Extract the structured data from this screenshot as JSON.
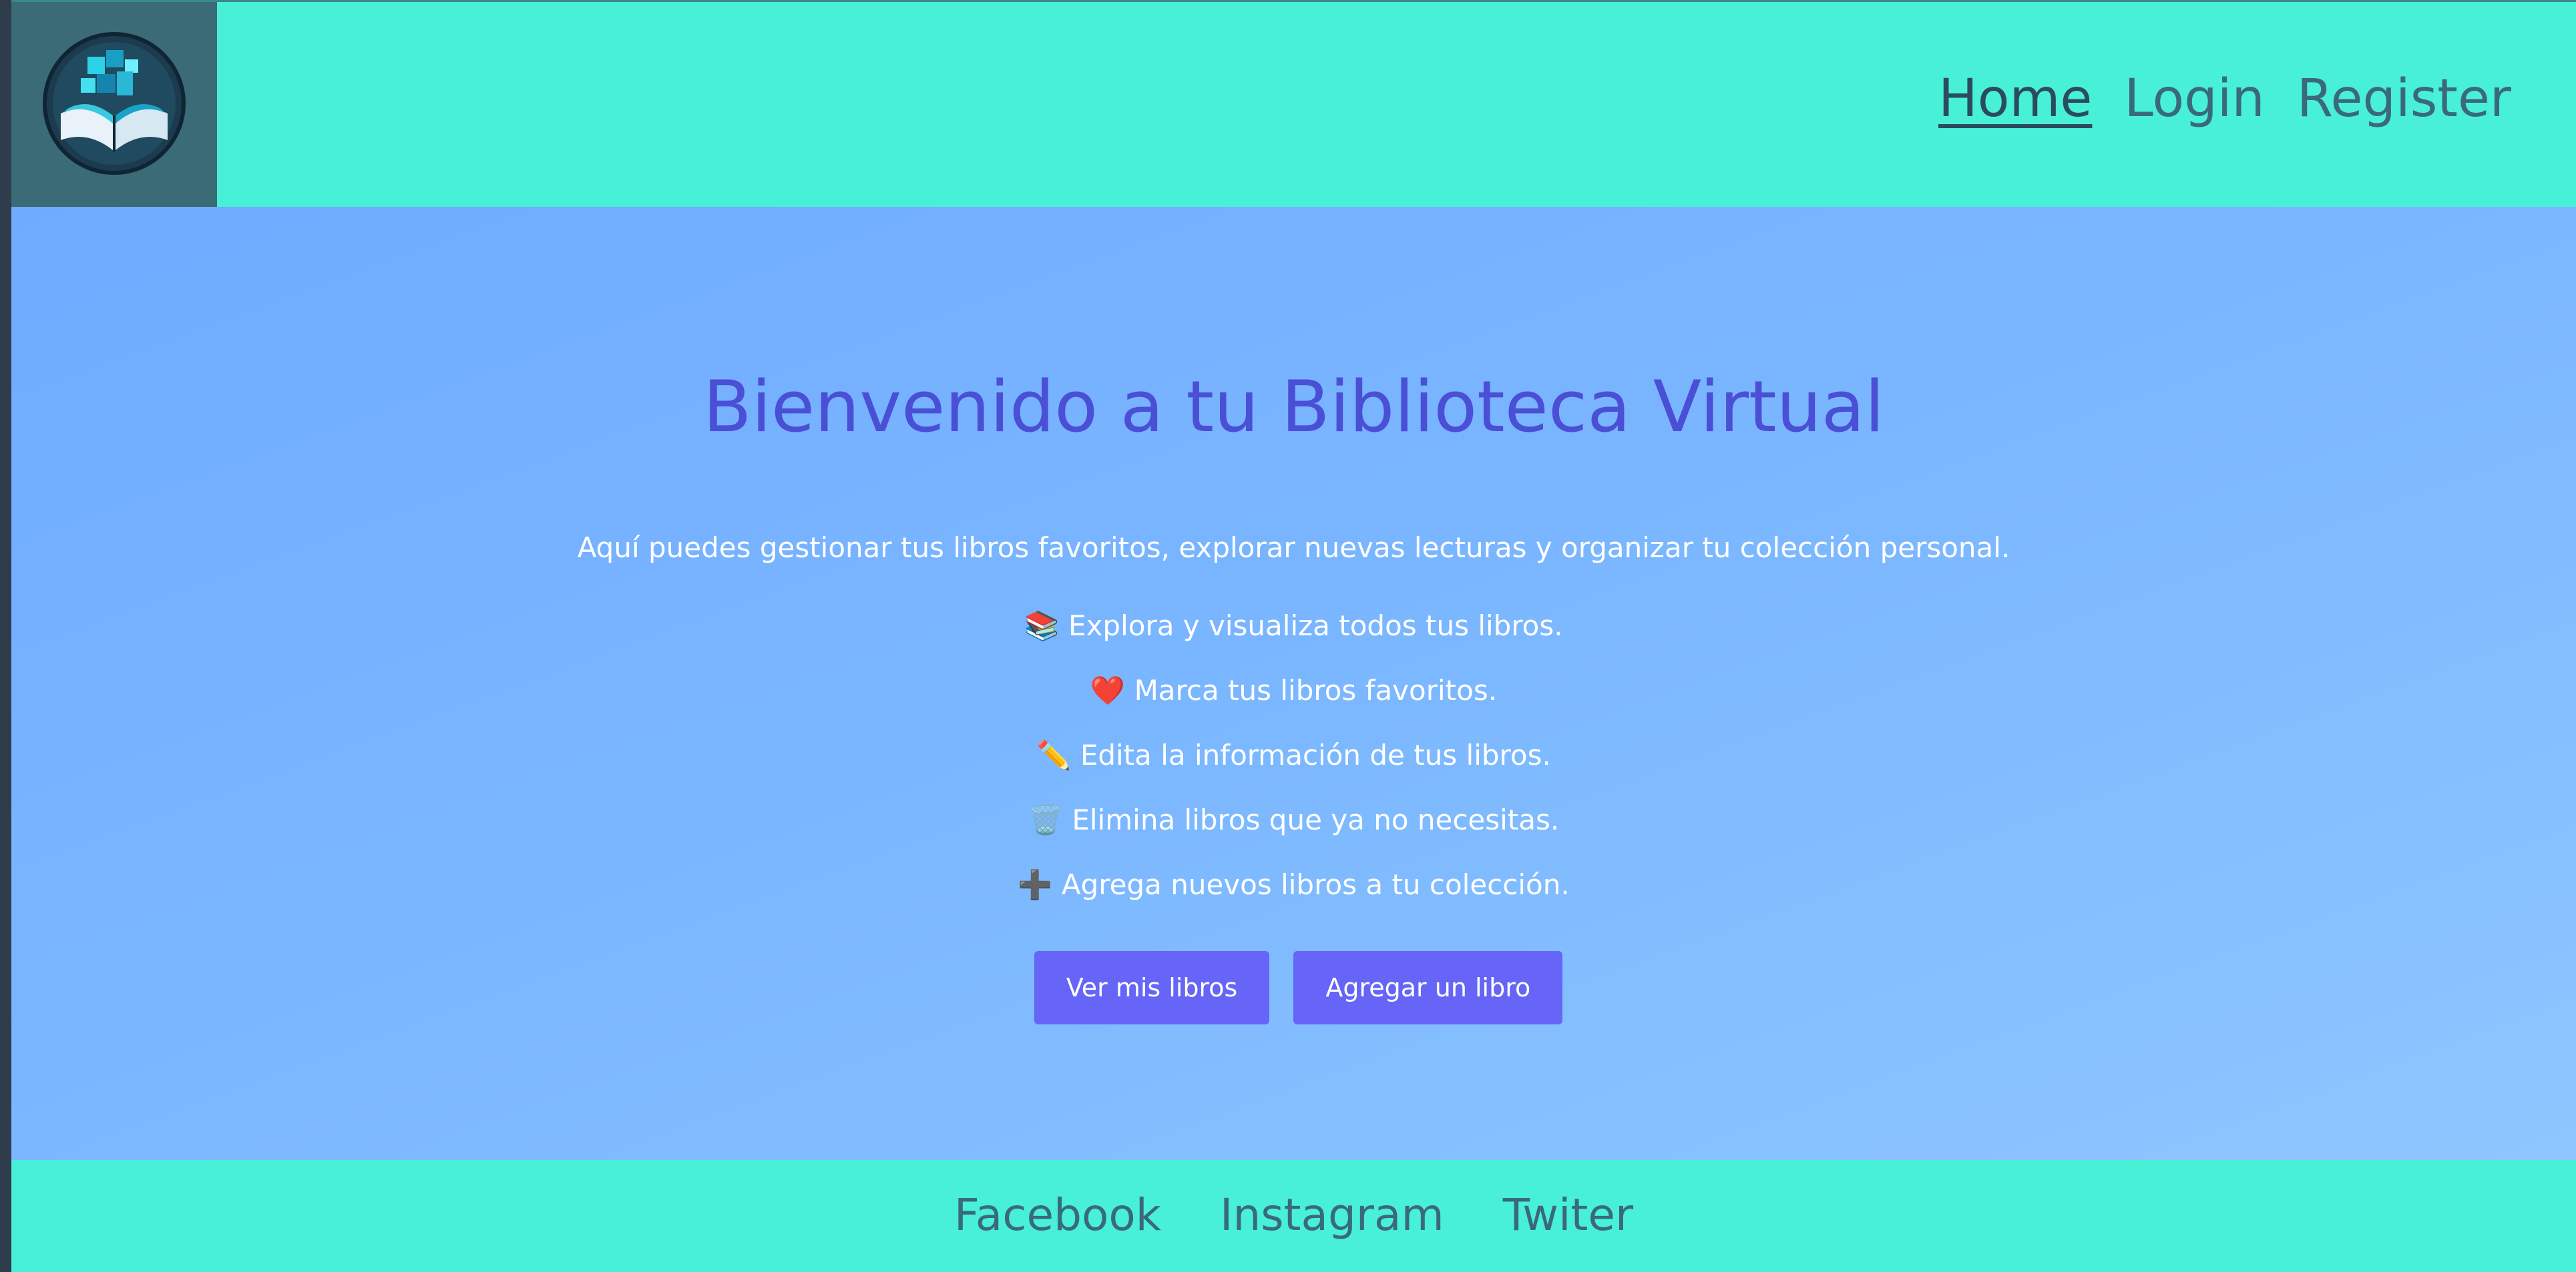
{
  "nav": {
    "items": [
      {
        "label": "Home",
        "active": true
      },
      {
        "label": "Login",
        "active": false
      },
      {
        "label": "Register",
        "active": false
      }
    ]
  },
  "hero": {
    "title": "Bienvenido a tu Biblioteca Virtual",
    "intro": "Aquí puedes gestionar tus libros favoritos, explorar nuevas lecturas y organizar tu colección personal.",
    "features": [
      "📚 Explora y visualiza todos tus libros.",
      "❤️ Marca tus libros favoritos.",
      "✏️ Edita la información de tus libros.",
      "🗑️ Elimina libros que ya no necesitas.",
      "➕ Agrega nuevos libros a tu colección."
    ],
    "primary_button": "Ver mis libros",
    "secondary_button": "Agregar un libro"
  },
  "footer": {
    "links": [
      "Facebook",
      "Instagram",
      "Twiter"
    ]
  },
  "colors": {
    "header_bg": "#48f0d8",
    "hero_bg_start": "#6fabff",
    "hero_bg_end": "#8ec6ff",
    "title_color": "#4a4fd6",
    "button_bg": "#6665f7"
  },
  "icons": {
    "logo": "book-logo-icon"
  }
}
